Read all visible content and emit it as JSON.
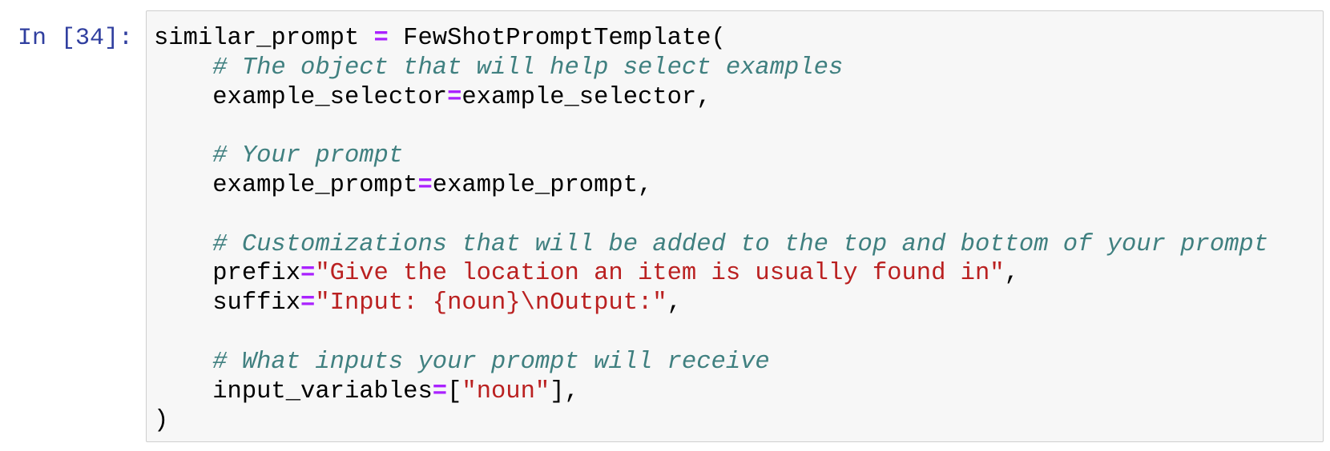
{
  "cell": {
    "prompt": "In [34]:",
    "colors": {
      "prompt": "#303f9f",
      "comment": "#408080",
      "string": "#ba2121",
      "operator": "#aa22ff",
      "background": "#f7f7f7",
      "border": "#cfcfcf"
    },
    "lines": [
      [
        {
          "t": "similar_prompt ",
          "c": "plain"
        },
        {
          "t": "=",
          "c": "op"
        },
        {
          "t": " FewShotPromptTemplate(",
          "c": "plain"
        }
      ],
      [
        {
          "t": "    ",
          "c": "plain"
        },
        {
          "t": "# The object that will help select examples",
          "c": "comment"
        }
      ],
      [
        {
          "t": "    example_selector",
          "c": "plain"
        },
        {
          "t": "=",
          "c": "op"
        },
        {
          "t": "example_selector,",
          "c": "plain"
        }
      ],
      [],
      [
        {
          "t": "    ",
          "c": "plain"
        },
        {
          "t": "# Your prompt",
          "c": "comment"
        }
      ],
      [
        {
          "t": "    example_prompt",
          "c": "plain"
        },
        {
          "t": "=",
          "c": "op"
        },
        {
          "t": "example_prompt,",
          "c": "plain"
        }
      ],
      [],
      [
        {
          "t": "    ",
          "c": "plain"
        },
        {
          "t": "# Customizations that will be added to the top and bottom of your prompt",
          "c": "comment"
        }
      ],
      [
        {
          "t": "    prefix",
          "c": "plain"
        },
        {
          "t": "=",
          "c": "op"
        },
        {
          "t": "\"Give the location an item is usually found in\"",
          "c": "string"
        },
        {
          "t": ",",
          "c": "plain"
        }
      ],
      [
        {
          "t": "    suffix",
          "c": "plain"
        },
        {
          "t": "=",
          "c": "op"
        },
        {
          "t": "\"Input: {noun}\\nOutput:\"",
          "c": "string"
        },
        {
          "t": ",",
          "c": "plain"
        }
      ],
      [],
      [
        {
          "t": "    ",
          "c": "plain"
        },
        {
          "t": "# What inputs your prompt will receive",
          "c": "comment"
        }
      ],
      [
        {
          "t": "    input_variables",
          "c": "plain"
        },
        {
          "t": "=",
          "c": "op"
        },
        {
          "t": "[",
          "c": "plain"
        },
        {
          "t": "\"noun\"",
          "c": "string"
        },
        {
          "t": "],",
          "c": "plain"
        }
      ],
      [
        {
          "t": ")",
          "c": "plain"
        }
      ]
    ]
  }
}
